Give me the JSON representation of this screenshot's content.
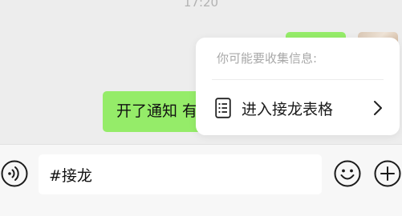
{
  "chat": {
    "timestamp": "17:20",
    "messages": [
      {
        "text": "开了通知 有"
      }
    ]
  },
  "popup": {
    "title": "你可能要收集信息:",
    "item": {
      "label": "进入接龙表格",
      "icon": "list-icon",
      "chevron": "chevron-right-icon"
    }
  },
  "input_bar": {
    "value": "#接龙",
    "icons": [
      "voice-icon",
      "emoji-icon",
      "plus-icon"
    ]
  },
  "colors": {
    "bubble": "#95ec69",
    "background": "#ededed",
    "input_bar": "#f7f7f7"
  }
}
